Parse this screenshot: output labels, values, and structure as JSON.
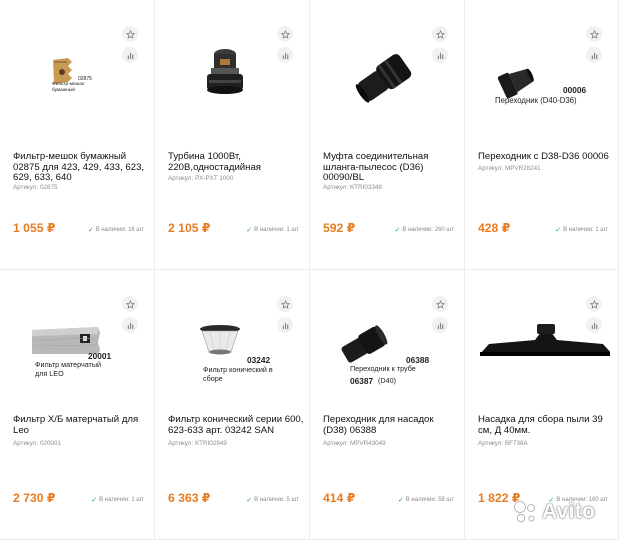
{
  "watermark": {
    "text": "Avito"
  },
  "colors": {
    "price": "#e87c21",
    "in_stock": "#2fa84f"
  },
  "products": [
    {
      "title": "Фильтр-мешок бумажный 02875 для 423, 429, 433, 623, 629, 633, 640",
      "sku": "Артикул: 02875",
      "price": "1 055 ₽",
      "stock": "В наличии: 16 шт",
      "img_code": "02875",
      "img_caption": "Фильтр-мешок бумажный"
    },
    {
      "title": "Турбина 1000Вт, 220В,одностадийная",
      "sku": "Артикул: PX-PXT 1000",
      "price": "2 105 ₽",
      "stock": "В наличии: 1 шт"
    },
    {
      "title": "Муфта соединительная шланга-пылесос (D36) 00090/BL",
      "sku": "Артикул: KTRI03348",
      "price": "592 ₽",
      "stock": "В наличии: 260 шт"
    },
    {
      "title": "Переходник с D38-D36 00006",
      "sku": "Артикул: MPVR28241",
      "price": "428 ₽",
      "stock": "В наличии: 1 шт",
      "img_code": "00006",
      "img_caption": "Переходник (D40-D36)"
    },
    {
      "title": "Фильтр Х/Б матерчатый для Leo",
      "sku": "Артикул: 020001",
      "price": "2 730 ₽",
      "stock": "В наличии: 1 шт",
      "img_code": "20001",
      "img_caption": "Фильтр матерчатый для LEO"
    },
    {
      "title": "Фильтр конический серии 600, 623-633 арт. 03242 SAN",
      "sku": "Артикул: KTRI02949",
      "price": "6 363 ₽",
      "stock": "В наличии: 5 шт",
      "img_code": "03242",
      "img_caption": "Фильтр конический в сборе"
    },
    {
      "title": "Переходник для насадок (D38) 06388",
      "sku": "Артикул: MPVR43049",
      "price": "414 ₽",
      "stock": "В наличии: 58 шт",
      "img_code": "06388",
      "img_caption": "Переходник к трубе",
      "img_code2": "06387",
      "img_caption2": "(D40)"
    },
    {
      "title": "Насадка для сбора пыли 39 см, Д 40мм.",
      "sku": "Артикул: BF738A",
      "price": "1 822 ₽",
      "stock": "В наличии: 160 шт"
    }
  ]
}
